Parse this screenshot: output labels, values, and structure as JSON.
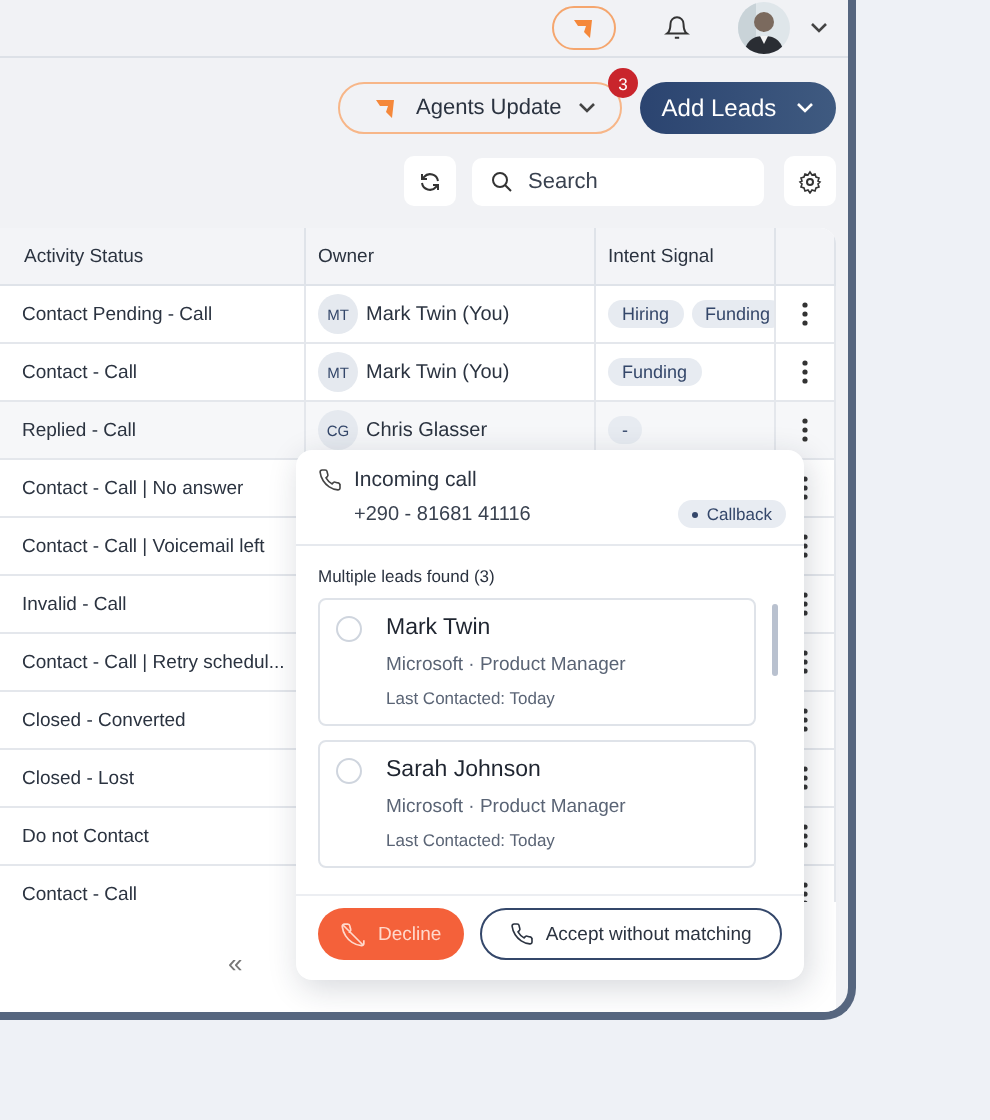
{
  "toolbar": {
    "agents_button": "Agents Update",
    "agents_badge": "3",
    "add_button": "Add Leads",
    "search": {
      "placeholder": "Search"
    }
  },
  "table": {
    "columns": [
      "Activity Status",
      "Owner",
      "Intent Signal"
    ],
    "rows": [
      {
        "status": "Contact Pending - Call",
        "owner": {
          "initials": "MT",
          "name": "Mark Twin (You)"
        },
        "signals": [
          "Hiring",
          "Funding"
        ]
      },
      {
        "status": "Contact - Call",
        "owner": {
          "initials": "MT",
          "name": "Mark Twin (You)"
        },
        "signals": [
          "Funding"
        ]
      },
      {
        "status": "Replied - Call",
        "owner": {
          "initials": "CG",
          "name": "Chris Glasser"
        },
        "signals": [
          "-"
        ]
      },
      {
        "status": "Contact - Call | No answer"
      },
      {
        "status": "Contact - Call | Voicemail left"
      },
      {
        "status": "Invalid - Call"
      },
      {
        "status": "Contact - Call | Retry schedul..."
      },
      {
        "status": "Closed - Converted"
      },
      {
        "status": "Closed - Lost"
      },
      {
        "status": "Do not Contact"
      },
      {
        "status": "Contact - Call"
      }
    ]
  },
  "pagination": {
    "first": "«"
  },
  "call_popup": {
    "title": "Incoming call",
    "phone": "+290 - 81681 41116",
    "tag": "Callback",
    "section": "Multiple leads found (3)",
    "leads": [
      {
        "name": "Mark Twin",
        "company_role": "Microsoft · Product Manager",
        "last_contacted": "Last Contacted: Today",
        "selected": false
      },
      {
        "name": "Sarah Johnson",
        "company_role": "Microsoft · Product Manager",
        "last_contacted": "Last Contacted: Today",
        "selected": false
      }
    ],
    "decline": "Decline",
    "accept": "Accept without matching"
  }
}
